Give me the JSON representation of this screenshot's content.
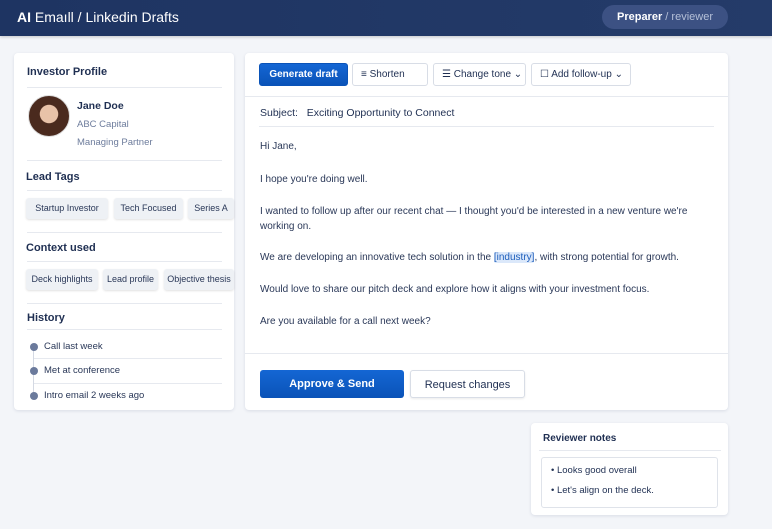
{
  "header": {
    "title_prefix": "AI",
    "title_rest": " Emaıll / Linkedin Drafts",
    "role_active": "Preparer",
    "role_sep": " / ",
    "role_other": "reviewer"
  },
  "profile": {
    "heading": "Investor Profile",
    "name": "Jane Doe",
    "company": "ABC Capital",
    "title": "Managing Partner"
  },
  "lead_tags": {
    "heading": "Lead Tags",
    "items": [
      "Startup Investor",
      "Tech Focused",
      "Series A"
    ]
  },
  "context": {
    "heading": "Context used",
    "items": [
      "Deck highlights",
      "Lead profile",
      "Objective thesis"
    ]
  },
  "history": {
    "heading": "History",
    "items": [
      "Call last week",
      "Met at conference",
      "Intro email 2 weeks ago"
    ]
  },
  "toolbar": {
    "generate": "Generate draft",
    "shorten": "Shorten",
    "tone": "Change tone",
    "followup": "Add follow-up"
  },
  "email": {
    "subject_label": "Subject:",
    "subject": "Exciting Opportunity to Connect",
    "greeting": "Hi Jane,",
    "p1": "I hope you're doing well.",
    "p2": "I wanted to follow up after our recent chat — I thought you'd be interested in a new venture we're working on.",
    "p3_before": "We are developing an innovative tech solution in the ",
    "p3_placeholder": "[industry]",
    "p3_after": ", with strong potential for growth.",
    "p4": "Would love to share our pitch deck and explore how it aligns with your investment focus.",
    "p5": "Are you available for a call next week?"
  },
  "actions": {
    "approve": "Approve & Send",
    "request": "Request changes"
  },
  "notes": {
    "heading": "Reviewer notes",
    "items": [
      "Looks good overall",
      "Let's align on the deck."
    ]
  },
  "colors": {
    "header": "#1e3462",
    "primary": "#0a53b8"
  }
}
